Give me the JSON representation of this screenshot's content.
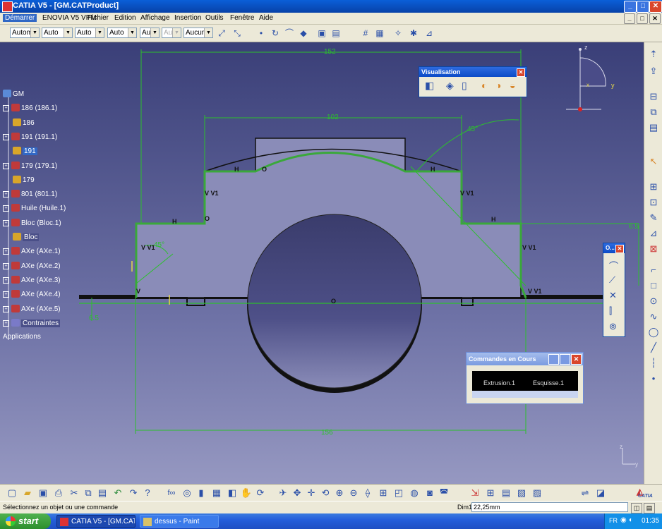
{
  "window": {
    "title": "CATIA V5 - [GM.CATProduct]",
    "controls": [
      "_",
      "□",
      "✕"
    ]
  },
  "menu": {
    "items": [
      "Démarrer",
      "ENOVIA V5 VPM",
      "Fichier",
      "Edition",
      "Affichage",
      "Insertion",
      "Outils",
      "Fenêtre",
      "Aide"
    ]
  },
  "toolbar": {
    "combos": [
      {
        "value": "Automat",
        "disabled": false
      },
      {
        "value": "Auto",
        "disabled": false
      },
      {
        "value": "Auto",
        "disabled": false
      },
      {
        "value": "Auto",
        "disabled": false
      },
      {
        "value": "Aut",
        "disabled": false
      },
      {
        "value": "Aut",
        "disabled": true
      },
      {
        "value": "Aucun",
        "disabled": false
      }
    ]
  },
  "tree": {
    "nodes": [
      {
        "label": "GM",
        "level": 0,
        "kind": "product",
        "style": ""
      },
      {
        "label": "186 (186.1)",
        "level": 1,
        "kind": "component",
        "style": ""
      },
      {
        "label": "186",
        "level": 2,
        "kind": "part",
        "style": ""
      },
      {
        "label": "191 (191.1)",
        "level": 1,
        "kind": "component",
        "style": ""
      },
      {
        "label": "191",
        "level": 2,
        "kind": "part",
        "style": "selected"
      },
      {
        "label": "179 (179.1)",
        "level": 1,
        "kind": "component",
        "style": ""
      },
      {
        "label": "179",
        "level": 2,
        "kind": "part",
        "style": ""
      },
      {
        "label": "801 (801.1)",
        "level": 1,
        "kind": "component",
        "style": ""
      },
      {
        "label": "Huile (Huile.1)",
        "level": 1,
        "kind": "component",
        "style": ""
      },
      {
        "label": "Bloc (Bloc.1)",
        "level": 1,
        "kind": "component",
        "style": ""
      },
      {
        "label": "Bloc",
        "level": 2,
        "kind": "part",
        "style": "boxed"
      },
      {
        "label": "AXe (AXe.1)",
        "level": 1,
        "kind": "component",
        "style": ""
      },
      {
        "label": "AXe (AXe.2)",
        "level": 1,
        "kind": "component",
        "style": ""
      },
      {
        "label": "AXe (AXe.3)",
        "level": 1,
        "kind": "component",
        "style": ""
      },
      {
        "label": "AXe (AXe.4)",
        "level": 1,
        "kind": "component",
        "style": ""
      },
      {
        "label": "AXe (AXe.5)",
        "level": 1,
        "kind": "component",
        "style": ""
      },
      {
        "label": "Contraintes",
        "level": 1,
        "kind": "constraints",
        "style": "boxed"
      },
      {
        "label": "Applications",
        "level": 0,
        "kind": "applications",
        "style": ""
      }
    ]
  },
  "sketch": {
    "dimensions": {
      "top_width": "152",
      "inner_width": "102",
      "angle_right": "45°",
      "angle_left": "45°",
      "right_offset": "6.5",
      "left_offset": "6.5",
      "bottom_width": "156"
    },
    "constraint_marks": {
      "h": "H",
      "v": "V",
      "vv": "V V1",
      "o": "O"
    },
    "colors": {
      "profile": "#3aa83a",
      "dimension": "#2cc02c",
      "part_face": "#8a8cb8",
      "disk": "#4a4c82"
    }
  },
  "compass": {
    "z_label": "z",
    "y_label": "y",
    "x_label": "x"
  },
  "corner_axis": {
    "z_label": "z",
    "y_label": "y"
  },
  "visualisation_panel": {
    "title": "Visualisation"
  },
  "small_panel": {
    "title": "O..."
  },
  "commands_panel": {
    "title": "Commandes en Cours",
    "item1": "Extrusion.1",
    "item2": "Esquisse.1"
  },
  "logo": {
    "text": "CATIA"
  },
  "status": {
    "message": "Sélectionnez un objet ou une commande",
    "field_label": "Dim1",
    "field_value": "22,25mm"
  },
  "taskbar": {
    "start_label": "start",
    "tasks": [
      "CATIA V5 - [GM.CAT...",
      "dessus - Paint"
    ],
    "language": "FR",
    "clock": "01:35"
  }
}
